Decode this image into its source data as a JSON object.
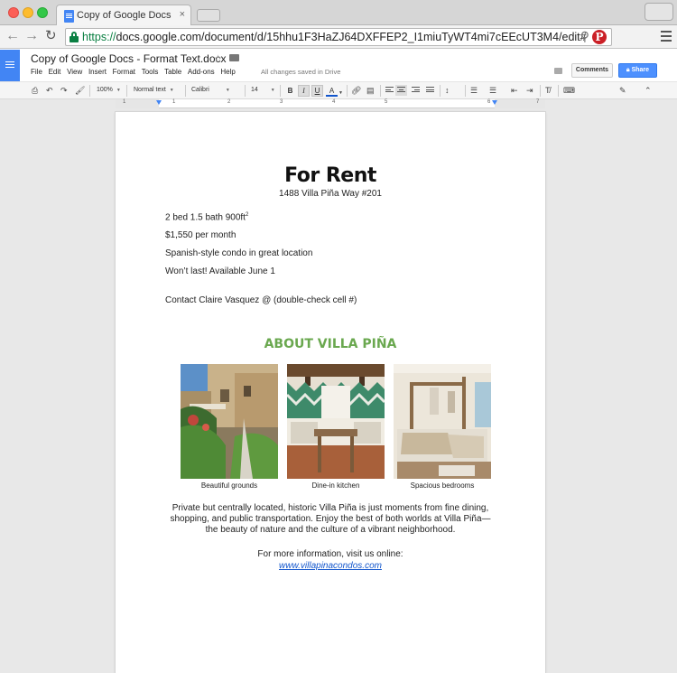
{
  "browser": {
    "tab_title": "Copy of Google Docs - Format Text.docx",
    "tab_close": "×",
    "url_scheme": "https://",
    "url_rest": "docs.google.com/document/d/15hhu1F3HaZJ64DXFFEP2_I1miuTyWT4mi7cEEcUT3M4/edit#",
    "pinterest_letter": "P"
  },
  "docs": {
    "title": "Copy of Google Docs - Format Text.docx",
    "menu": [
      "File",
      "Edit",
      "View",
      "Insert",
      "Format",
      "Tools",
      "Table",
      "Add-ons",
      "Help"
    ],
    "save_status": "All changes saved in Drive",
    "comments_label": "Comments",
    "share_label": "Share"
  },
  "toolbar": {
    "zoom": "100%",
    "style": "Normal text",
    "font": "Calibri",
    "size": "14",
    "bold": "B",
    "italic": "I",
    "underline": "U",
    "text_color": "A",
    "clear_format": "T̸"
  },
  "ruler": {
    "numbers": [
      "1",
      "1",
      "2",
      "3",
      "4",
      "5",
      "6",
      "7"
    ]
  },
  "document": {
    "heading": "For Rent",
    "address": "1488 Villa Piña Way #201",
    "line1_text": "2 bed 1.5 bath 900ft",
    "line1_sup": "2",
    "line2": "$1,550 per month",
    "line3": "Spanish-style condo in great location",
    "line4": "Won’t last! Available June 1",
    "contact": "Contact Claire Vasquez @ (double-check cell #)",
    "about_heading": "ABOUT VILLA PIÑA",
    "captions": [
      "Beautiful grounds",
      "Dine-in kitchen",
      "Spacious bedrooms"
    ],
    "description": "Private but centrally located, historic Villa Piña is just moments from fine dining, shopping, and public transportation. Enjoy the best of both worlds at Villa Piña—the beauty of nature and the culture of a vibrant neighborhood.",
    "more_info": "For more information, visit us online:",
    "link": "www.villapinacondos.com"
  },
  "colors": {
    "accent_green": "#6aa84f",
    "share_blue": "#4d90fe",
    "link_blue": "#1155cc",
    "docs_blue": "#4285f4"
  }
}
